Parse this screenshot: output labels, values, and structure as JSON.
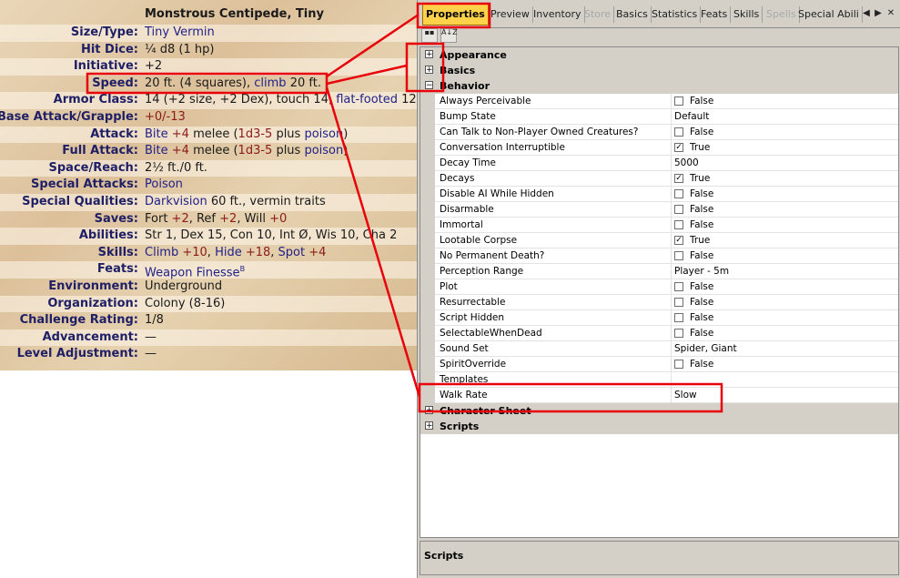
{
  "statblock": {
    "title": "Monstrous Centipede, Tiny",
    "rows": [
      {
        "label": "Size/Type:",
        "segments": [
          {
            "t": "Tiny Vermin",
            "c": "lnk"
          }
        ]
      },
      {
        "label": "Hit Dice:",
        "segments": [
          {
            "t": "¼ d8 (1 hp)",
            "c": ""
          }
        ]
      },
      {
        "label": "Initiative:",
        "segments": [
          {
            "t": "+2",
            "c": ""
          }
        ]
      },
      {
        "label": "Speed:",
        "segments": [
          {
            "t": "20 ft. (4 squares), ",
            "c": ""
          },
          {
            "t": "climb",
            "c": "lnk"
          },
          {
            "t": " 20 ft.",
            "c": ""
          }
        ]
      },
      {
        "label": "Armor Class:",
        "segments": [
          {
            "t": "14 (+2 size, +2 Dex), touch 14, ",
            "c": ""
          },
          {
            "t": "flat-footed",
            "c": "lnk"
          },
          {
            "t": " 12",
            "c": ""
          }
        ]
      },
      {
        "label": "Base Attack/Grapple:",
        "segments": [
          {
            "t": "+0/-13",
            "c": "num"
          }
        ]
      },
      {
        "label": "Attack:",
        "segments": [
          {
            "t": "Bite",
            "c": "lnk"
          },
          {
            "t": " +4",
            "c": "num"
          },
          {
            "t": " melee (",
            "c": ""
          },
          {
            "t": "1d3-5",
            "c": "num"
          },
          {
            "t": " plus ",
            "c": ""
          },
          {
            "t": "poison",
            "c": "lnk"
          },
          {
            "t": ")",
            "c": ""
          }
        ]
      },
      {
        "label": "Full Attack:",
        "segments": [
          {
            "t": "Bite",
            "c": "lnk"
          },
          {
            "t": " +4",
            "c": "num"
          },
          {
            "t": " melee (",
            "c": ""
          },
          {
            "t": "1d3-5",
            "c": "num"
          },
          {
            "t": " plus ",
            "c": ""
          },
          {
            "t": "poison",
            "c": "lnk"
          },
          {
            "t": ")",
            "c": ""
          }
        ]
      },
      {
        "label": "Space/Reach:",
        "segments": [
          {
            "t": "2½ ft./0 ft.",
            "c": ""
          }
        ]
      },
      {
        "label": "Special Attacks:",
        "segments": [
          {
            "t": "Poison",
            "c": "lnk"
          }
        ]
      },
      {
        "label": "Special Qualities:",
        "segments": [
          {
            "t": "Darkvision",
            "c": "lnk"
          },
          {
            "t": " 60 ft., vermin traits",
            "c": ""
          }
        ]
      },
      {
        "label": "Saves:",
        "segments": [
          {
            "t": "Fort ",
            "c": ""
          },
          {
            "t": "+2",
            "c": "num"
          },
          {
            "t": ", Ref ",
            "c": ""
          },
          {
            "t": "+2",
            "c": "num"
          },
          {
            "t": ", Will ",
            "c": ""
          },
          {
            "t": "+0",
            "c": "num"
          }
        ]
      },
      {
        "label": "Abilities:",
        "segments": [
          {
            "t": "Str 1, Dex 15, Con 10, Int Ø, Wis 10, Cha 2",
            "c": ""
          }
        ]
      },
      {
        "label": "Skills:",
        "segments": [
          {
            "t": "Climb",
            "c": "lnk"
          },
          {
            "t": " +10",
            "c": "num"
          },
          {
            "t": ", ",
            "c": ""
          },
          {
            "t": "Hide",
            "c": "lnk"
          },
          {
            "t": " +18",
            "c": "num"
          },
          {
            "t": ", ",
            "c": ""
          },
          {
            "t": "Spot",
            "c": "lnk"
          },
          {
            "t": " +4",
            "c": "num"
          }
        ]
      },
      {
        "label": "Feats:",
        "segments": [
          {
            "t": "Weapon Finesse",
            "c": "lnk"
          },
          {
            "t": "B",
            "c": "sup"
          }
        ]
      },
      {
        "label": "Environment:",
        "segments": [
          {
            "t": "Underground",
            "c": ""
          }
        ]
      },
      {
        "label": "Organization:",
        "segments": [
          {
            "t": "Colony (8-16)",
            "c": ""
          }
        ]
      },
      {
        "label": "Challenge Rating:",
        "segments": [
          {
            "t": "1/8",
            "c": ""
          }
        ]
      },
      {
        "label": "Advancement:",
        "segments": [
          {
            "t": "—",
            "c": ""
          }
        ]
      },
      {
        "label": "Level Adjustment:",
        "segments": [
          {
            "t": "—",
            "c": ""
          }
        ]
      }
    ]
  },
  "panel": {
    "tabs": [
      {
        "label": "Properties",
        "state": "active"
      },
      {
        "label": "Preview",
        "state": "normal"
      },
      {
        "label": "Inventory",
        "state": "normal"
      },
      {
        "label": "Store",
        "state": "disabled"
      },
      {
        "label": "Basics",
        "state": "normal"
      },
      {
        "label": "Statistics",
        "state": "normal"
      },
      {
        "label": "Feats",
        "state": "normal"
      },
      {
        "label": "Skills",
        "state": "normal"
      },
      {
        "label": "Spells",
        "state": "disabled"
      },
      {
        "label": "Special Abili",
        "state": "normal"
      }
    ],
    "nav": {
      "prev": "◀",
      "next": "▶",
      "close": "✕"
    },
    "toolbar": {
      "categorized_glyph": "▪▪",
      "alpha_glyph": "A↓Z"
    },
    "categories": [
      {
        "name": "Appearance",
        "expanded": false,
        "expander": "+"
      },
      {
        "name": "Basics",
        "expanded": false,
        "expander": "+"
      },
      {
        "name": "Behavior",
        "expanded": true,
        "expander": "−",
        "properties": [
          {
            "name": "Always Perceivable",
            "value": "False",
            "kind": "bool",
            "checked": false
          },
          {
            "name": "Bump State",
            "value": "Default",
            "kind": "text"
          },
          {
            "name": "Can Talk to Non-Player Owned Creatures?",
            "value": "False",
            "kind": "bool",
            "checked": false
          },
          {
            "name": "Conversation Interruptible",
            "value": "True",
            "kind": "bool",
            "checked": true
          },
          {
            "name": "Decay Time",
            "value": "5000",
            "kind": "text"
          },
          {
            "name": "Decays",
            "value": "True",
            "kind": "bool",
            "checked": true
          },
          {
            "name": "Disable AI While Hidden",
            "value": "False",
            "kind": "bool",
            "checked": false
          },
          {
            "name": "Disarmable",
            "value": "False",
            "kind": "bool",
            "checked": false
          },
          {
            "name": "Immortal",
            "value": "False",
            "kind": "bool",
            "checked": false
          },
          {
            "name": "Lootable Corpse",
            "value": "True",
            "kind": "bool",
            "checked": true
          },
          {
            "name": "No Permanent Death?",
            "value": "False",
            "kind": "bool",
            "checked": false
          },
          {
            "name": "Perception Range",
            "value": "Player - 5m",
            "kind": "text"
          },
          {
            "name": "Plot",
            "value": "False",
            "kind": "bool",
            "checked": false
          },
          {
            "name": "Resurrectable",
            "value": "False",
            "kind": "bool",
            "checked": false
          },
          {
            "name": "Script Hidden",
            "value": "False",
            "kind": "bool",
            "checked": false
          },
          {
            "name": "SelectableWhenDead",
            "value": "False",
            "kind": "bool",
            "checked": false
          },
          {
            "name": "Sound Set",
            "value": "Spider, Giant",
            "kind": "text"
          },
          {
            "name": "SpiritOverride",
            "value": "False",
            "kind": "bool",
            "checked": false
          },
          {
            "name": "Templates",
            "value": "",
            "kind": "text"
          },
          {
            "name": "Walk Rate",
            "value": "Slow",
            "kind": "text"
          }
        ]
      },
      {
        "name": "Character Sheet",
        "expanded": false,
        "expander": "+"
      },
      {
        "name": "Scripts",
        "expanded": false,
        "expander": "+"
      }
    ],
    "description_title": "Scripts"
  },
  "colors": {
    "highlight": "#e8000a",
    "active_tab": "#ffd24a",
    "link": "#1f1f88",
    "number": "#8b1a1a",
    "label": "#1f1f66"
  }
}
